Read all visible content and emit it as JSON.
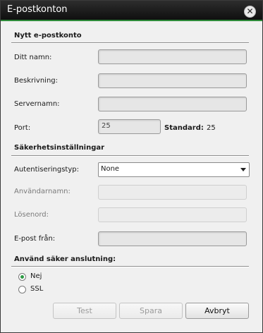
{
  "window": {
    "title": "E-postkonton",
    "close_glyph": "✕"
  },
  "sections": {
    "new_account": "Nytt e-postkonto",
    "security": "Säkerhetsinställningar",
    "secure_connection": "Använd säker anslutning:"
  },
  "fields": {
    "name": {
      "label": "Ditt namn:",
      "value": ""
    },
    "description": {
      "label": "Beskrivning:",
      "value": ""
    },
    "server": {
      "label": "Servernamn:",
      "value": ""
    },
    "port": {
      "label": "Port:",
      "value": "25",
      "standard_label": "Standard:",
      "standard_value": "25"
    },
    "auth_type": {
      "label": "Autentiseringstyp:",
      "value": "None"
    },
    "username": {
      "label": "Användarnamn:",
      "value": "",
      "disabled": true
    },
    "password": {
      "label": "Lösenord:",
      "value": "",
      "disabled": true
    },
    "from_email": {
      "label": "E-post från:",
      "value": ""
    }
  },
  "secure_options": [
    {
      "label": "Nej",
      "checked": true
    },
    {
      "label": "SSL",
      "checked": false
    }
  ],
  "buttons": {
    "test": {
      "label": "Test",
      "disabled": true
    },
    "save": {
      "label": "Spara",
      "disabled": true
    },
    "cancel": {
      "label": "Avbryt",
      "disabled": false
    }
  },
  "colors": {
    "accent": "#2e8b3a",
    "titlebar": "#1a1a1a",
    "radio_checked": "#2e9a45"
  }
}
